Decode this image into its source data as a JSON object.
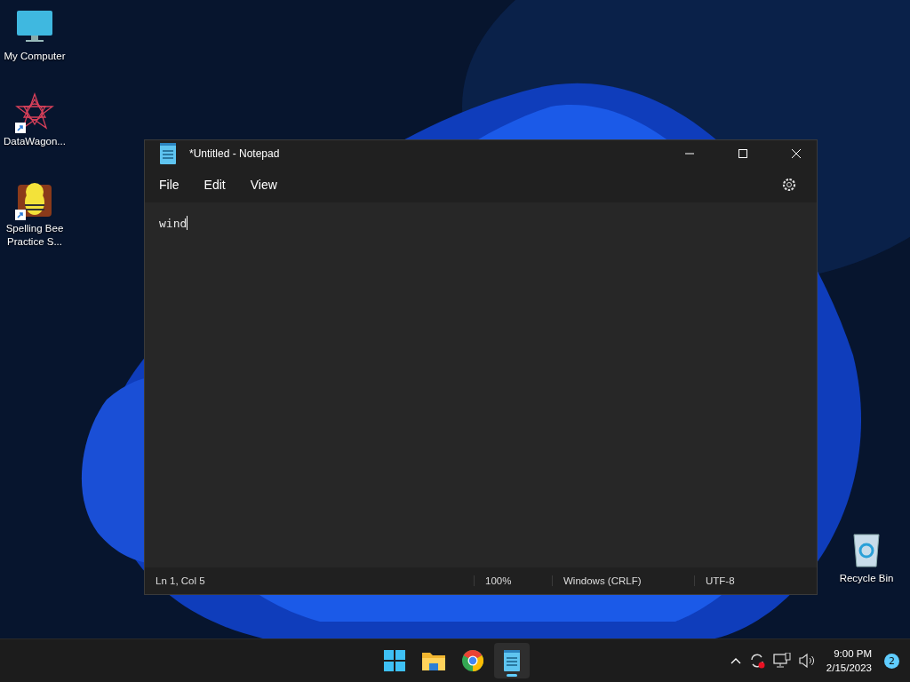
{
  "desktop_icons": [
    {
      "label": "My Computer",
      "kind": "computer",
      "shortcut": false
    },
    {
      "label": "DataWagon...",
      "kind": "star",
      "shortcut": true
    },
    {
      "label": "Spelling Bee\nPractice S...",
      "kind": "bee",
      "shortcut": true
    },
    {
      "label": "Recycle Bin",
      "kind": "recycle",
      "shortcut": false
    }
  ],
  "window": {
    "title": "*Untitled - Notepad",
    "menu": [
      "File",
      "Edit",
      "View"
    ],
    "text": "wind",
    "status_bar": [
      "Ln 1, Col 5",
      "100%",
      "Windows (CRLF)",
      "UTF-8"
    ]
  },
  "taskbar": {
    "apps": [
      {
        "kind": "start",
        "selected": false
      },
      {
        "kind": "folder",
        "selected": false
      },
      {
        "kind": "chrome",
        "selected": false
      },
      {
        "kind": "notepad",
        "selected": true
      }
    ],
    "time": "9:00 PM",
    "date": "2/15/2023",
    "notifications": "2"
  }
}
